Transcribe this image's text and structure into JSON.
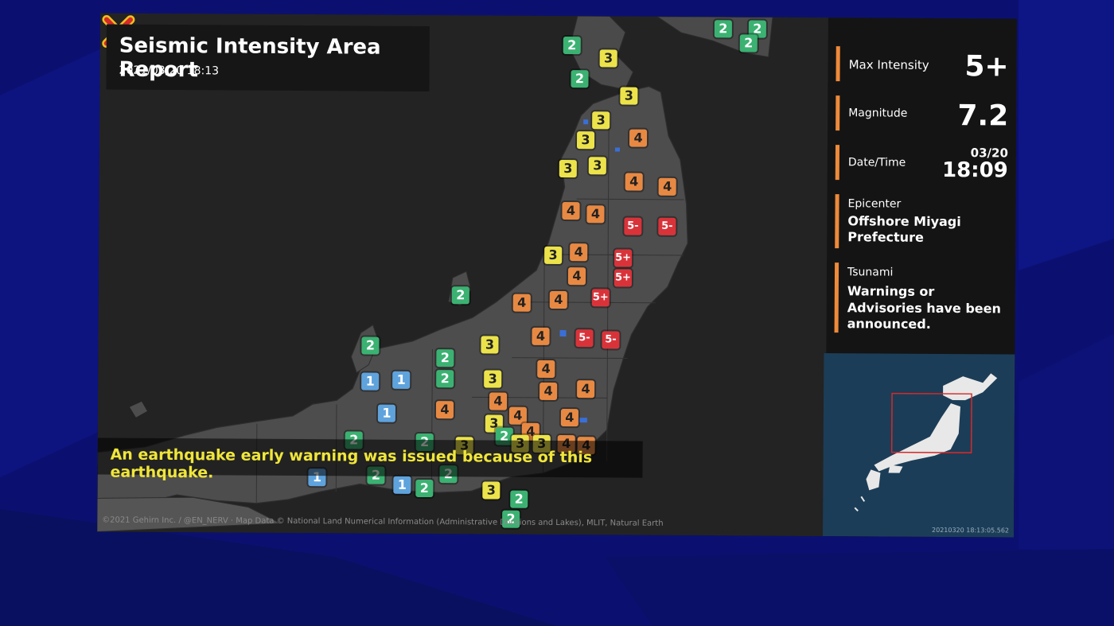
{
  "title": "Seismic Intensity Area Report",
  "issued": "2021/03/20 18:13",
  "info": {
    "max_intensity_label": "Max Intensity",
    "max_intensity_value": "5+",
    "magnitude_label": "Magnitude",
    "magnitude_value": "7.2",
    "datetime_label": "Date/Time",
    "date_value": "03/20",
    "time_value": "18:09",
    "epicenter_label": "Epicenter",
    "epicenter_line1": "Offshore Miyagi",
    "epicenter_line2": "Prefecture",
    "tsunami_label": "Tsunami",
    "tsunami_line1": "Warnings or",
    "tsunami_line2": "Advisories have been",
    "tsunami_line3": "announced."
  },
  "caption": "An earthquake early warning was issued because of this earthquake.",
  "credit": "©2021 Gehirn Inc. / @EN_NERV · Map Data © National Land Numerical Information (Administrative Divisions and Lakes), MLIT, Natural Earth",
  "inset_stamp": "20210320 18:13:05.562",
  "badges": [
    "2",
    "3",
    "2",
    "3",
    "3",
    "4",
    "3",
    "3",
    "3",
    "4",
    "4",
    "4",
    "4",
    "5-",
    "5-",
    "3",
    "4",
    "5+",
    "4",
    "5+",
    "2",
    "4",
    "4",
    "5+",
    "2",
    "3",
    "4",
    "5-",
    "5-",
    "1",
    "1",
    "2",
    "3",
    "4",
    "2",
    "4",
    "4",
    "1",
    "4",
    "4",
    "3",
    "4",
    "4",
    "2",
    "2",
    "3",
    "4",
    "3",
    "3",
    "4",
    "4",
    "1",
    "2",
    "2",
    "1",
    "2",
    "3",
    "2",
    "2",
    "2",
    "2",
    "2",
    "2"
  ],
  "colors": {
    "i1": "#5fa3dd",
    "i2": "#3bb272",
    "i3": "#ece34a",
    "i4": "#e88943",
    "i5": "#d9333a",
    "accent": "#ee8a3a"
  }
}
